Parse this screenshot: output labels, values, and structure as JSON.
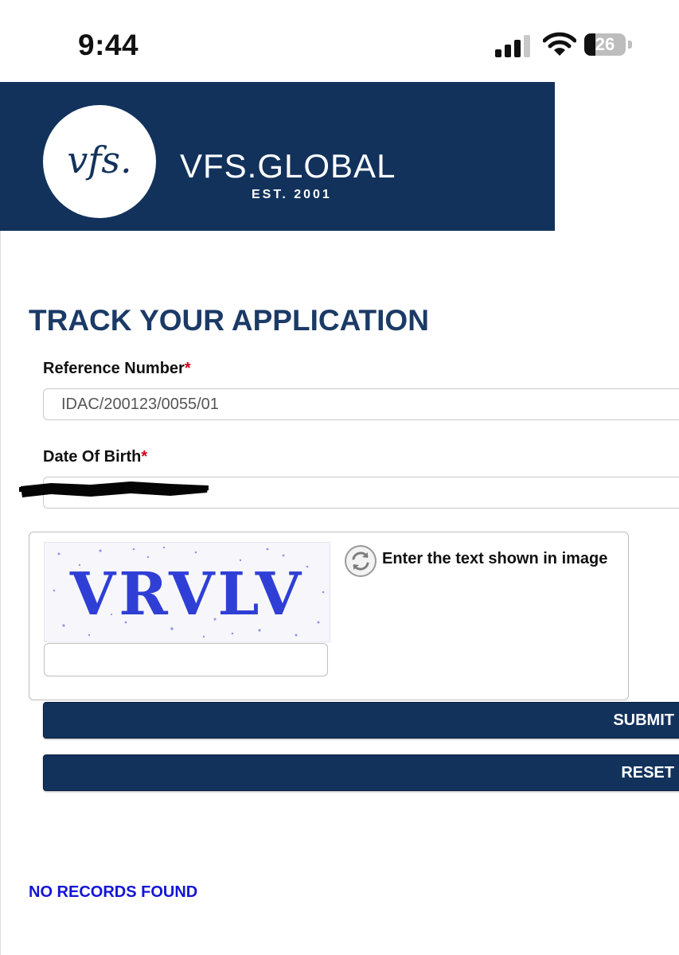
{
  "status_bar": {
    "time": "9:44",
    "battery": "26",
    "icons": [
      "cellular-signal-icon",
      "wifi-icon",
      "battery-icon"
    ]
  },
  "header": {
    "logo_mark": "vfs.",
    "brand_name": "VFS.GLOBAL",
    "established": "EST. 2001"
  },
  "form": {
    "title": "TRACK YOUR APPLICATION",
    "reference_label": "Reference Number",
    "reference_value": "IDAC/200123/0055/01",
    "dob_label": "Date Of Birth",
    "dob_value": "",
    "required_marker": "*",
    "captcha_code": "VRVLV",
    "captcha_hint": "Enter the text shown in image",
    "captcha_input": "",
    "submit_label": "SUBMIT",
    "reset_label": "RESET"
  },
  "result": {
    "message": "NO RECORDS FOUND"
  },
  "colors": {
    "brand_navy": "#12325c",
    "title_blue": "#1b3a66",
    "required_red": "#d0021b",
    "captcha_blue": "#2f3fd6",
    "message_blue": "#1414d6"
  }
}
